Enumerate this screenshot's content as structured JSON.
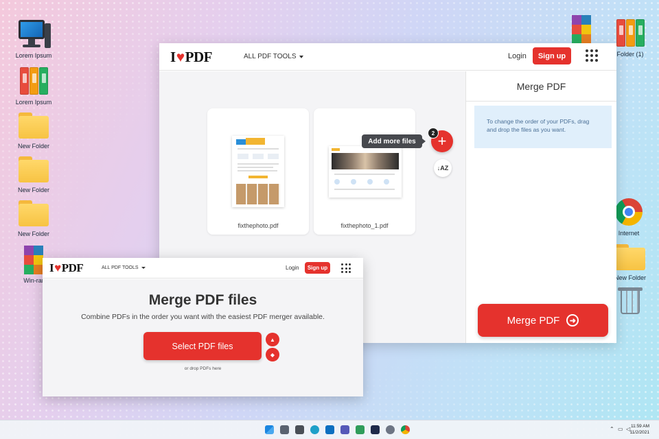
{
  "desktop": {
    "icons_left": [
      {
        "label": "Lorem Ipsum",
        "icon": "computer-icon"
      },
      {
        "label": "Lorem Ipsum",
        "icon": "binders-icon"
      },
      {
        "label": "New Folder",
        "icon": "folder-icon"
      },
      {
        "label": "New Folder",
        "icon": "folder-icon"
      },
      {
        "label": "New Folder",
        "icon": "folder-icon"
      },
      {
        "label": "Win-rar",
        "icon": "winrar-icon"
      }
    ],
    "icons_right": [
      {
        "label": "",
        "icon": "winrar-icon"
      },
      {
        "label": "Folder (1)",
        "icon": "binders-icon"
      },
      {
        "label": "Internet",
        "icon": "chrome-icon"
      },
      {
        "label": "New Folder",
        "icon": "folder-icon"
      },
      {
        "label": "",
        "icon": "recycle-bin-icon"
      }
    ]
  },
  "main_window": {
    "logo": {
      "left": "I",
      "heart": "♥",
      "right": "PDF"
    },
    "nav_tools": "ALL PDF TOOLS",
    "login": "Login",
    "signup": "Sign up",
    "files": [
      {
        "name": "fixthephoto.pdf"
      },
      {
        "name": "fixthephoto_1.pdf"
      }
    ],
    "tooltip": "Add more files",
    "file_count_badge": "2",
    "add_symbol": "+",
    "sort_symbol": "↓AZ",
    "panel": {
      "title": "Merge PDF",
      "info": "To change the order of your PDFs, drag and drop the files as you want.",
      "merge_button": "Merge PDF",
      "merge_arrow": "➜"
    }
  },
  "secondary_window": {
    "logo": {
      "left": "I",
      "heart": "♥",
      "right": "PDF"
    },
    "nav_tools": "ALL PDF TOOLS",
    "login": "Login",
    "signup": "Sign up",
    "heading": "Merge PDF files",
    "subheading": "Combine PDFs in the order you want with the easiest PDF merger available.",
    "select_button": "Select PDF files",
    "drop_hint": "or drop PDFs here",
    "google_drive_symbol": "▲",
    "dropbox_symbol": "◆"
  },
  "taskbar": {
    "time": "11:59 AM",
    "date": "11/2/2021"
  },
  "colors": {
    "brand_red": "#e5322d",
    "info_blue": "#e0effb"
  }
}
